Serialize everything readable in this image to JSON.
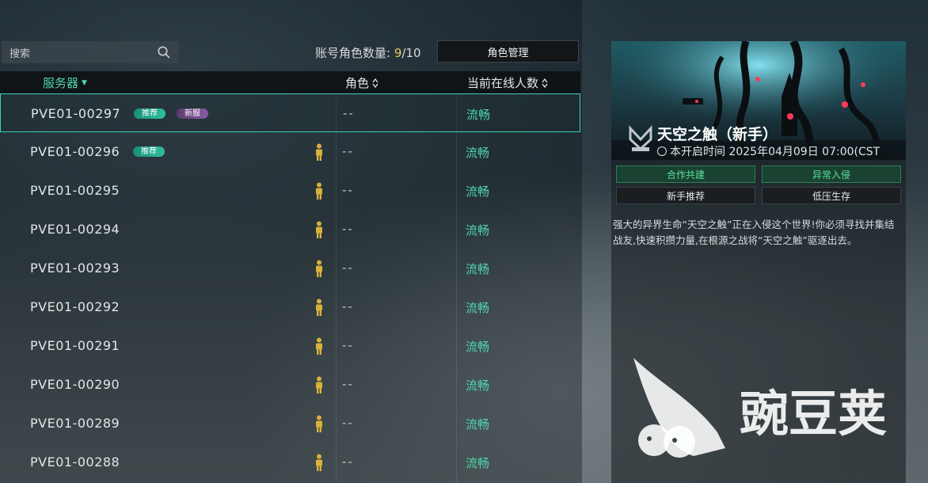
{
  "search": {
    "placeholder": "搜索",
    "icon": "search-icon"
  },
  "account": {
    "label": "账号角色数量: ",
    "current": "9",
    "sep": "/",
    "max": "10"
  },
  "manage_button": "角色管理",
  "table": {
    "headers": {
      "server": "服务器",
      "role": "角色",
      "online": "当前在线人数"
    },
    "rows": [
      {
        "name": "PVE01-00297",
        "badges": [
          "推荐",
          "新服"
        ],
        "role": "--",
        "status": "流畅",
        "selected": true
      },
      {
        "name": "PVE01-00296",
        "badges": [
          "推荐"
        ],
        "role": "--",
        "status": "流畅"
      },
      {
        "name": "PVE01-00295",
        "role": "--",
        "status": "流畅"
      },
      {
        "name": "PVE01-00294",
        "role": "--",
        "status": "流畅"
      },
      {
        "name": "PVE01-00293",
        "role": "--",
        "status": "流畅"
      },
      {
        "name": "PVE01-00292",
        "role": "--",
        "status": "流畅"
      },
      {
        "name": "PVE01-00291",
        "role": "--",
        "status": "流畅"
      },
      {
        "name": "PVE01-00290",
        "role": "--",
        "status": "流畅"
      },
      {
        "name": "PVE01-00289",
        "role": "--",
        "status": "流畅"
      },
      {
        "name": "PVE01-00288",
        "role": "--",
        "status": "流畅"
      }
    ]
  },
  "detail": {
    "title": "天空之触（新手）",
    "open_time_label": "本开启时间 ",
    "open_time": "2025年04月09日 07:00(CST",
    "tags": [
      "合作共建",
      "异常入侵",
      "新手推荐",
      "低压生存"
    ],
    "description": "强大的异界生命“天空之触”正在入侵这个世界!你必须寻找并集结战友,快速积攒力量,在根源之战将“天空之触”驱逐出去。"
  },
  "watermark": "豌豆荚",
  "colors": {
    "accent": "#4fd7b0",
    "count_highlight": "#e8c85a",
    "tag_green": "#5be09a",
    "badge_new": "#8b5aa6"
  }
}
